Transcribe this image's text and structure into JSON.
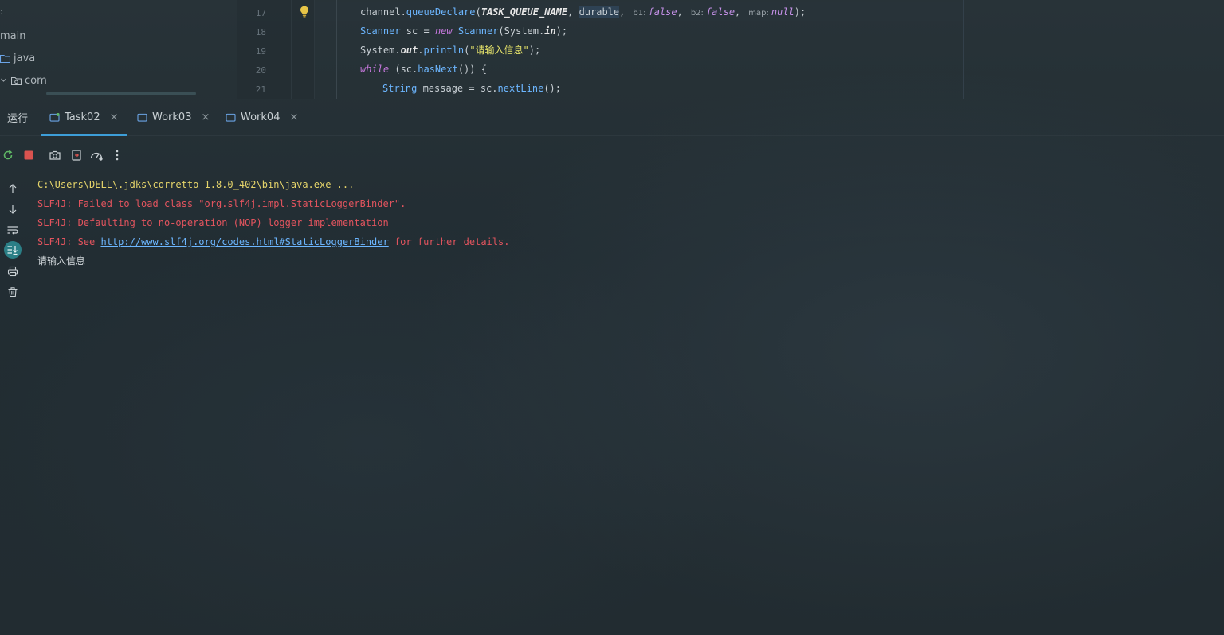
{
  "project_tree": {
    "items": [
      {
        "label": "main",
        "icon": "none"
      },
      {
        "label": "java",
        "icon": "folder-icon"
      },
      {
        "label": "com",
        "icon": "package-folder-icon"
      }
    ]
  },
  "editor": {
    "line_numbers": [
      "17",
      "18",
      "19",
      "20",
      "21"
    ],
    "lines": {
      "l17": {
        "recv": "channel.",
        "method": "queueDeclare",
        "open": "(",
        "arg1": "TASK_QUEUE_NAME",
        "sep1": ", ",
        "arg2": "durable",
        "sep2": ",",
        "hint_b1": "b1:",
        "val_b1": "false",
        "sep3": ",",
        "hint_b2": "b2:",
        "val_b2": "false",
        "sep4": ",",
        "hint_map": "map:",
        "val_map": "null",
        "close": ");"
      },
      "l18": {
        "type1": "Scanner",
        "var": " sc = ",
        "kw_new": "new",
        "type2": " Scanner",
        "p1": "(System.",
        "field": "in",
        "close": ");"
      },
      "l19": {
        "sys": "System.",
        "out": "out",
        "dot": ".",
        "method": "println",
        "open": "(",
        "str": "\"请输入信息\"",
        "close": ");"
      },
      "l20": {
        "kw_while": "while",
        "p1": " (sc.",
        "method": "hasNext",
        "close": "()) {"
      },
      "l21": {
        "type": "String",
        "p1": " message = sc.",
        "method": "nextLine",
        "close": "();"
      }
    }
  },
  "run_panel": {
    "title": "运行",
    "tabs": [
      {
        "label": "Task02",
        "close": "×"
      },
      {
        "label": "Work03",
        "close": "×"
      },
      {
        "label": "Work04",
        "close": "×"
      }
    ]
  },
  "console": {
    "cmd": "C:\\Users\\DELL\\.jdks\\corretto-1.8.0_402\\bin\\java.exe ...",
    "err1": "SLF4J: Failed to load class \"org.slf4j.impl.StaticLoggerBinder\".",
    "err2": "SLF4J: Defaulting to no-operation (NOP) logger implementation",
    "err3_prefix": "SLF4J: See ",
    "err3_link": "http://www.slf4j.org/codes.html#StaticLoggerBinder",
    "err3_suffix": " for further details.",
    "output": "请输入信息"
  },
  "colors": {
    "accent": "#3d9ed8",
    "error": "#e2545e",
    "command": "#e5d46a",
    "link": "#6cb6ff"
  }
}
